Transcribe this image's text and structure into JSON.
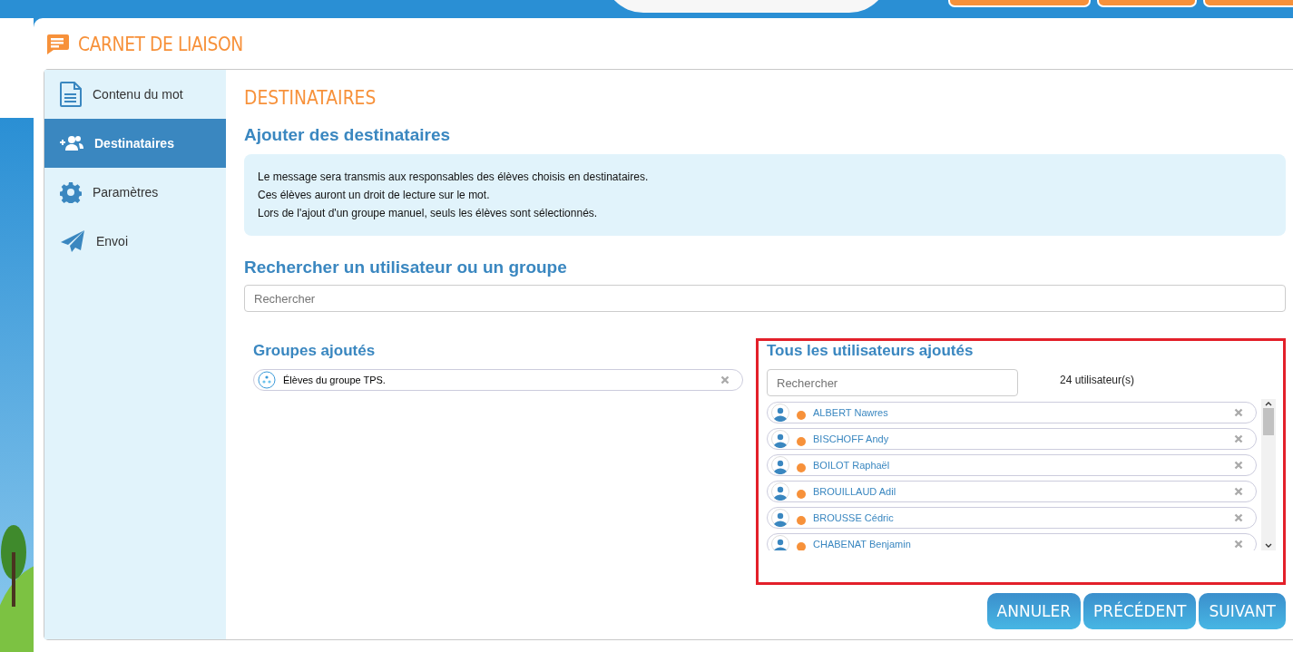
{
  "app": {
    "title": "CARNET DE LIAISON"
  },
  "sidebar": {
    "items": [
      {
        "label": "Contenu du mot",
        "kind": "document",
        "selected": false
      },
      {
        "label": "Destinataires",
        "kind": "people",
        "selected": true
      },
      {
        "label": "Paramètres",
        "kind": "gear",
        "selected": false
      },
      {
        "label": "Envoi",
        "kind": "send",
        "selected": false
      }
    ]
  },
  "page_title": "DESTINATAIRES",
  "add_section": {
    "heading": "Ajouter des destinataires",
    "info_lines": [
      "Le message sera transmis aux responsables des élèves choisis en destinataires.",
      "Ces élèves auront un droit de lecture sur le mot.",
      "Lors de l'ajout d'un groupe manuel, seuls les élèves sont sélectionnés."
    ]
  },
  "search_section": {
    "heading": "Rechercher un utilisateur ou un groupe",
    "search": {
      "placeholder": "Rechercher"
    }
  },
  "groups": {
    "heading": "Groupes ajoutés",
    "items": [
      {
        "label": "Élèves du groupe TPS."
      }
    ]
  },
  "users": {
    "heading": "Tous les utilisateurs ajoutés",
    "search": {
      "placeholder": "Rechercher"
    },
    "count": "24 utilisateur(s)",
    "items": [
      {
        "name": "ALBERT Nawres",
        "color": "#f7913a"
      },
      {
        "name": "BISCHOFF Andy",
        "color": "#f7913a"
      },
      {
        "name": "BOILOT Raphaël",
        "color": "#f7913a"
      },
      {
        "name": "BROUILLAUD Adil",
        "color": "#f7913a"
      },
      {
        "name": "BROUSSE Cédric",
        "color": "#f7913a"
      },
      {
        "name": "CHABENAT Benjamin",
        "color": "#f7913a"
      }
    ]
  },
  "buttons": [
    "ANNULER",
    "PRÉCÉDENT",
    "SUIVANT"
  ]
}
